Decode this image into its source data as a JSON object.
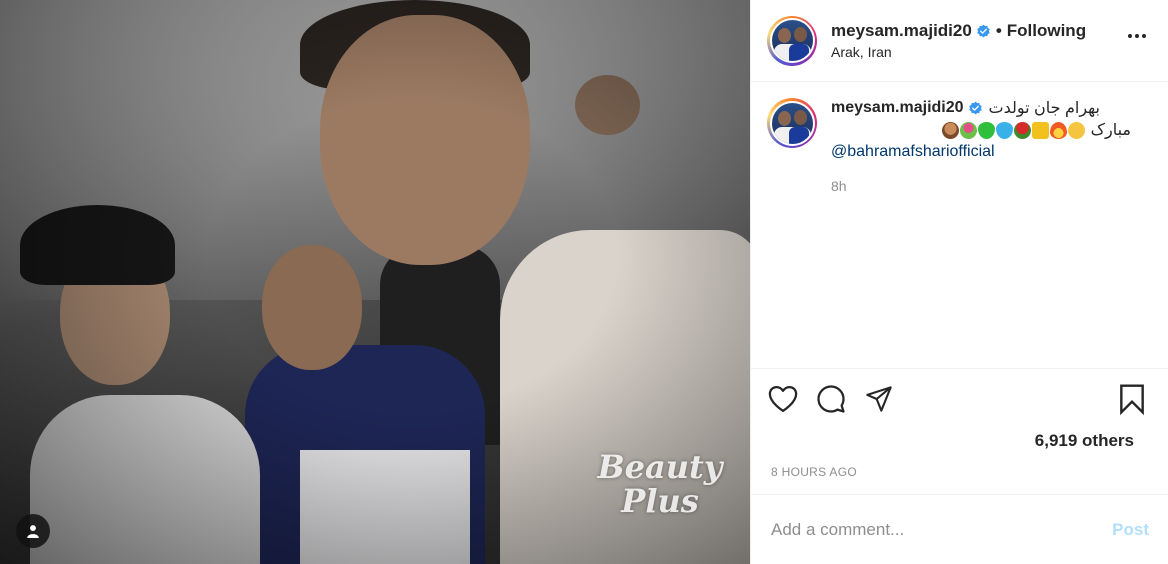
{
  "photo": {
    "watermark_line1": "Beauty",
    "watermark_line2": "Plus",
    "user_tag_icon": "user-icon"
  },
  "header": {
    "username": "meysam.majidi20",
    "verified_icon": "verified-badge-icon",
    "separator": "•",
    "follow_state": "Following",
    "location": "Arak, Iran",
    "more_icon": "more-options-icon"
  },
  "caption": {
    "username": "meysam.majidi20",
    "text_line1": "بهرام جان تولدت",
    "text_line2": "مبارک",
    "emojis": [
      "cake",
      "bouquet",
      "green-heart",
      "blue-heart",
      "rose",
      "crown",
      "fire",
      "clapping-hands"
    ],
    "mention": "@bahramafshariofficial",
    "time": "8h"
  },
  "actions": {
    "like_icon": "heart-icon",
    "comment_icon": "comment-icon",
    "share_icon": "share-icon",
    "save_icon": "bookmark-icon",
    "likes_text": "6,919 others",
    "timestamp": "8 HOURS AGO"
  },
  "add_comment": {
    "placeholder": "Add a comment...",
    "post_label": "Post"
  },
  "colors": {
    "verified": "#3897f0",
    "link": "#00376b",
    "post_disabled": "#b2dffc",
    "muted": "#8e8e8e"
  }
}
